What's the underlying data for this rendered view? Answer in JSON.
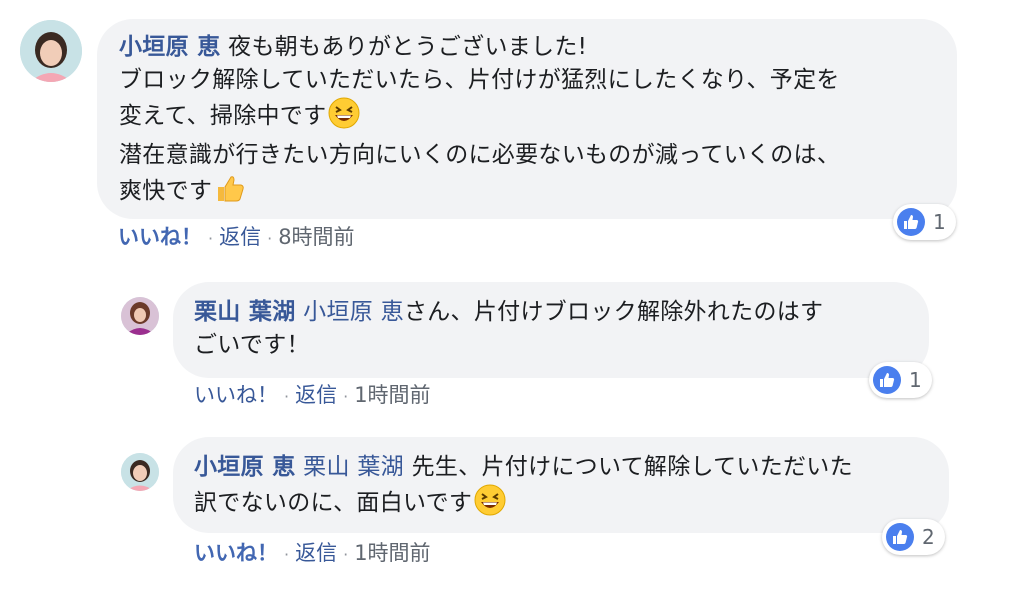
{
  "comments": [
    {
      "author": "小垣原 恵",
      "lines": [
        "夜も朝もありがとうございました!",
        "ブロック解除していただいたら、片付けが猛烈にしたくなり、予定を",
        "変えて、掃除中です",
        "潜在意識が行きたい方向にいくのに必要ないものが減っていくのは、",
        "爽快です"
      ],
      "emojis": [
        "grinning-squinting-face",
        "thumbs-up"
      ],
      "like_label": "いいね！",
      "reply_label": "返信",
      "time": "8時間前",
      "reaction_count": "1"
    },
    {
      "author": "栗山 葉湖",
      "mention": "小垣原 恵",
      "lines": [
        "さん、片付けブロック解除外れたのはす",
        "ごいです！"
      ],
      "like_label": "いいね！",
      "reply_label": "返信",
      "time": "1時間前",
      "reaction_count": "1"
    },
    {
      "author": "小垣原 恵",
      "mention": "栗山 葉湖",
      "lines": [
        "先生、片付けについて解除していただいた",
        "訳でないのに、面白いです"
      ],
      "emojis": [
        "grinning-squinting-face"
      ],
      "like_label": "いいね！",
      "reply_label": "返信",
      "time": "1時間前",
      "reaction_count": "2"
    }
  ],
  "separator": "·",
  "colors": {
    "link": "#385898",
    "bubble": "#f2f3f5",
    "like_blue": "#4a7fee"
  }
}
